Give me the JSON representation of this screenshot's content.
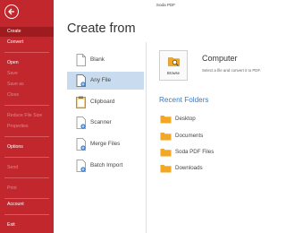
{
  "window": {
    "title": "Soda PDF"
  },
  "sidebar": {
    "items": [
      {
        "label": "Create",
        "active": true
      },
      {
        "label": "Convert"
      },
      {
        "label": "Open"
      },
      {
        "label": "Save",
        "disabled": true
      },
      {
        "label": "Save as",
        "disabled": true
      },
      {
        "label": "Close",
        "disabled": true
      },
      {
        "label": "Reduce File Size",
        "disabled": true
      },
      {
        "label": "Properties",
        "disabled": true
      },
      {
        "label": "Options"
      },
      {
        "label": "Send",
        "disabled": true
      },
      {
        "label": "Print",
        "disabled": true
      },
      {
        "label": "Account"
      },
      {
        "label": "Exit"
      }
    ]
  },
  "main": {
    "title": "Create from",
    "sources": [
      {
        "label": "Blank",
        "icon": "blank-page-icon"
      },
      {
        "label": "Any File",
        "icon": "file-add-icon",
        "selected": true
      },
      {
        "label": "Clipboard",
        "icon": "clipboard-icon"
      },
      {
        "label": "Scanner",
        "icon": "scanner-icon"
      },
      {
        "label": "Merge Files",
        "icon": "merge-files-icon"
      },
      {
        "label": "Batch Import",
        "icon": "batch-import-icon"
      }
    ]
  },
  "computer": {
    "browse_label": "Browse",
    "title": "Computer",
    "description": "Select a file and convert it to PDF."
  },
  "recent": {
    "title": "Recent Folders",
    "folders": [
      "Desktop",
      "Documents",
      "Soda PDF Files",
      "Downloads"
    ]
  },
  "colors": {
    "accent": "#c1272d",
    "selection": "#c9dcef",
    "link": "#3a7ac2",
    "folder": "#f2a825"
  }
}
